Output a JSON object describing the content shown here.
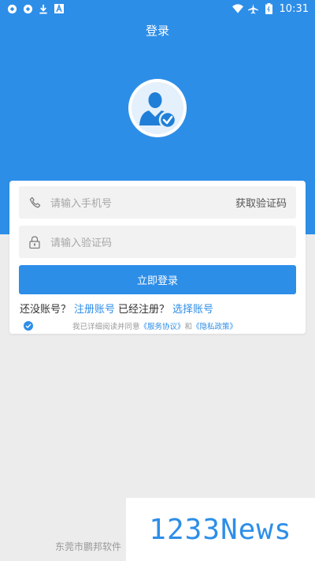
{
  "status_bar": {
    "time": "10:31",
    "left_icons": [
      "sync-icon",
      "sync-icon",
      "download-icon",
      "font-icon"
    ],
    "right_icons": [
      "wifi-icon",
      "airplane-icon",
      "battery-icon"
    ]
  },
  "header": {
    "title": "登录"
  },
  "avatar": {
    "icon": "user-verified-icon"
  },
  "form": {
    "phone_placeholder": "请输入手机号",
    "get_code_label": "获取验证码",
    "code_placeholder": "请输入验证码",
    "login_label": "立即登录"
  },
  "register_row": {
    "no_account": "还没账号？",
    "register_link": "注册账号",
    "already": "已经注册？",
    "select_link": "选择账号"
  },
  "agreement": {
    "prefix": "我已详细阅读并同意",
    "service_link": "《服务协议》",
    "and": "和",
    "privacy_link": "《隐私政策》"
  },
  "footer": {
    "text": "东莞市鹏邦软件"
  },
  "watermark": {
    "text": "1233News"
  },
  "colors": {
    "primary": "#2d8ee8",
    "background": "#ececec"
  }
}
